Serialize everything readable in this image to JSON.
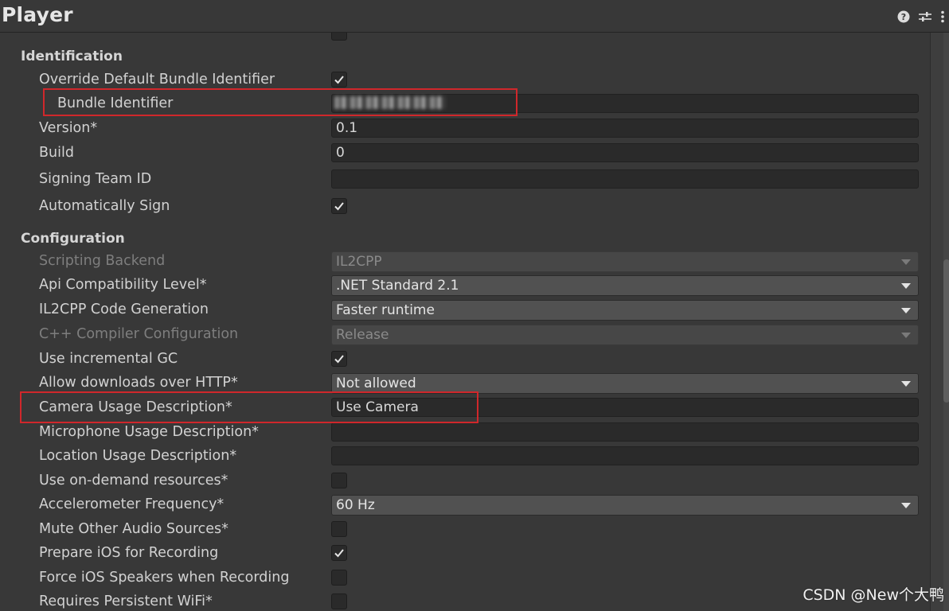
{
  "window": {
    "title": "Player",
    "help_icon": "help-icon",
    "preset_icon": "preset-icon",
    "menu_icon": "kebab-menu-icon"
  },
  "identification": {
    "header": "Identification",
    "override_bundle_label": "Override Default Bundle Identifier",
    "override_bundle_checked": true,
    "bundle_identifier_label": "Bundle Identifier",
    "bundle_identifier_value": "",
    "version_label": "Version*",
    "version_value": "0.1",
    "build_label": "Build",
    "build_value": "0",
    "signing_team_label": "Signing Team ID",
    "signing_team_value": "",
    "auto_sign_label": "Automatically Sign",
    "auto_sign_checked": true
  },
  "configuration": {
    "header": "Configuration",
    "scripting_backend_label": "Scripting Backend",
    "scripting_backend_value": "IL2CPP",
    "api_compat_label": "Api Compatibility Level*",
    "api_compat_value": ".NET Standard 2.1",
    "il2cpp_codegen_label": "IL2CPP Code Generation",
    "il2cpp_codegen_value": "Faster runtime",
    "cpp_compiler_label": "C++ Compiler Configuration",
    "cpp_compiler_value": "Release",
    "incremental_gc_label": "Use incremental GC",
    "incremental_gc_checked": true,
    "http_label": "Allow downloads over HTTP*",
    "http_value": "Not allowed",
    "camera_label": "Camera Usage Description*",
    "camera_value": "Use Camera",
    "microphone_label": "Microphone Usage Description*",
    "microphone_value": "",
    "location_label": "Location Usage Description*",
    "location_value": "",
    "on_demand_label": "Use on-demand resources*",
    "on_demand_checked": false,
    "accel_label": "Accelerometer Frequency*",
    "accel_value": "60 Hz",
    "mute_audio_label": "Mute Other Audio Sources*",
    "mute_audio_checked": false,
    "prepare_recording_label": "Prepare iOS for Recording",
    "prepare_recording_checked": true,
    "force_speakers_label": "Force iOS Speakers when Recording",
    "force_speakers_checked": false,
    "persistent_wifi_label": "Requires Persistent WiFi*",
    "persistent_wifi_checked": false
  },
  "watermark": "CSDN @New个大鸭",
  "colors": {
    "background": "#383838",
    "field": "#2a2a2a",
    "dropdown": "#515151",
    "highlight": "#d0272b"
  }
}
